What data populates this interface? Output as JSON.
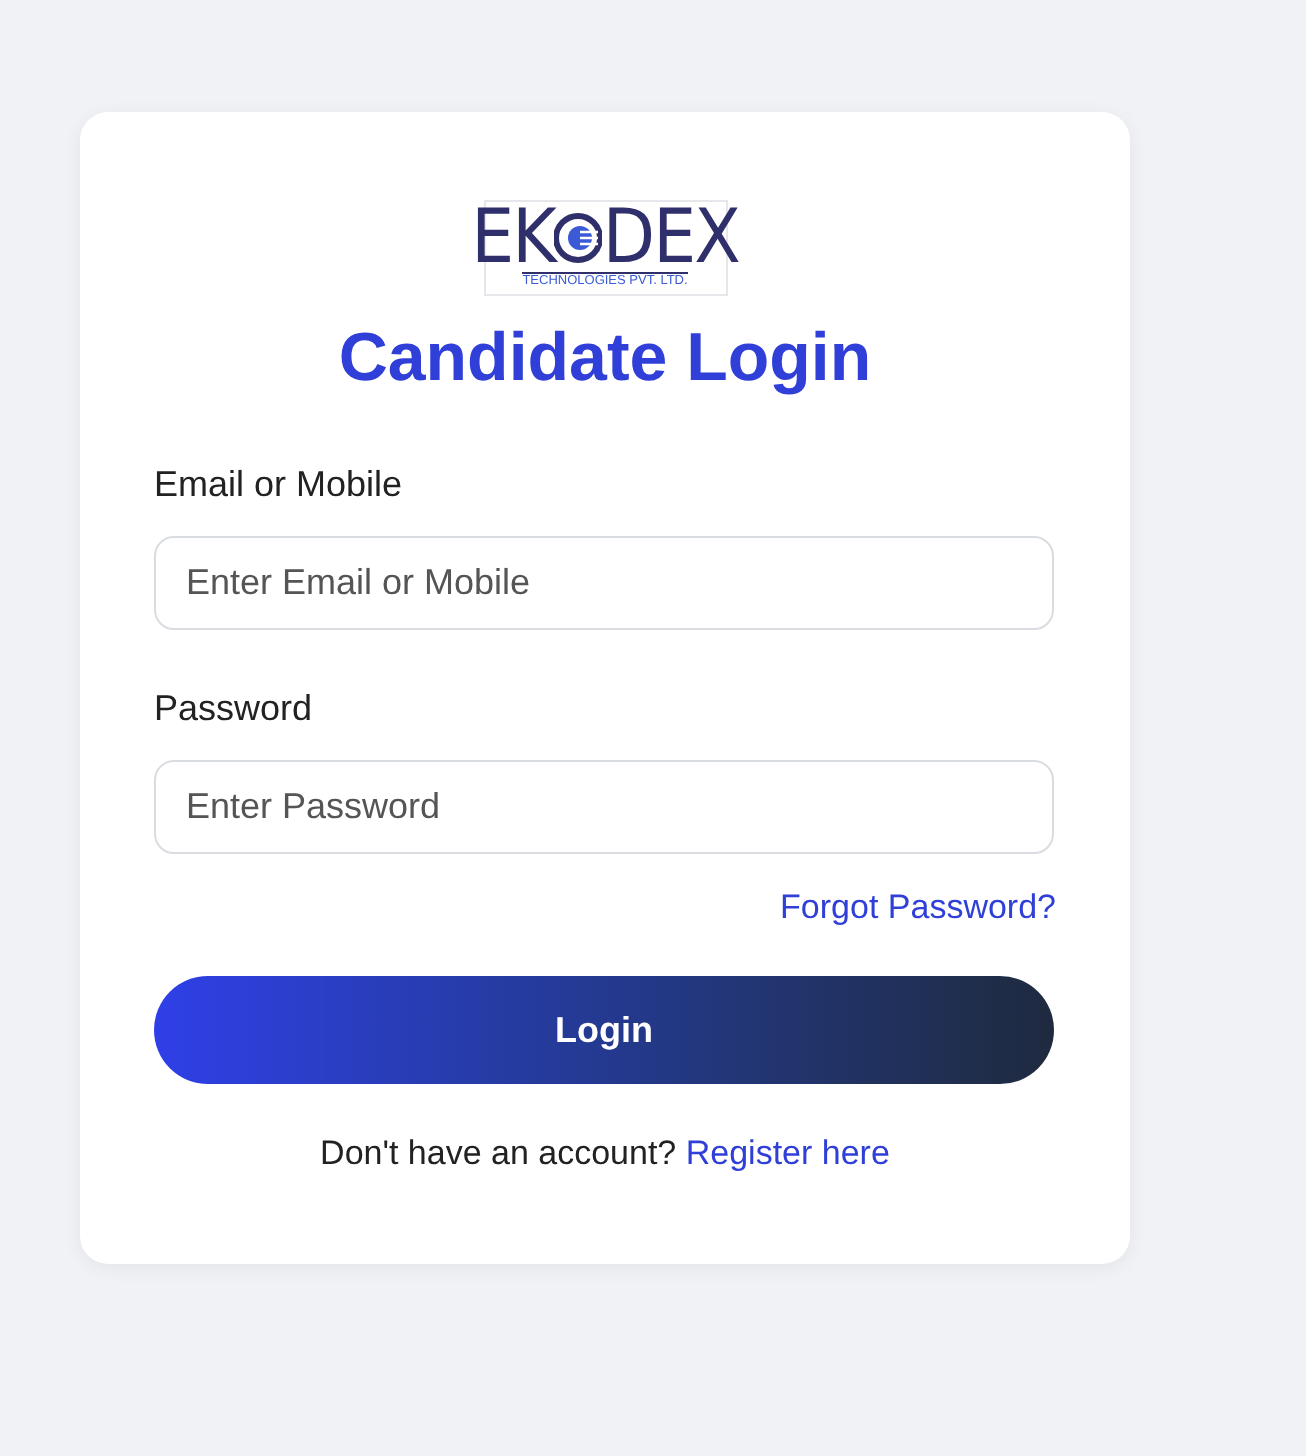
{
  "logo": {
    "left": "EK",
    "right": "DEX",
    "tagline": "TECHNOLOGIES PVT. LTD."
  },
  "title": "Candidate Login",
  "fields": [
    {
      "label": "Email or Mobile",
      "placeholder": "Enter Email or Mobile"
    },
    {
      "label": "Password",
      "placeholder": "Enter Password"
    }
  ],
  "forgot_link": "Forgot Password?",
  "login_button": "Login",
  "register_prompt": "Don't have an account?",
  "register_link": "Register here"
}
